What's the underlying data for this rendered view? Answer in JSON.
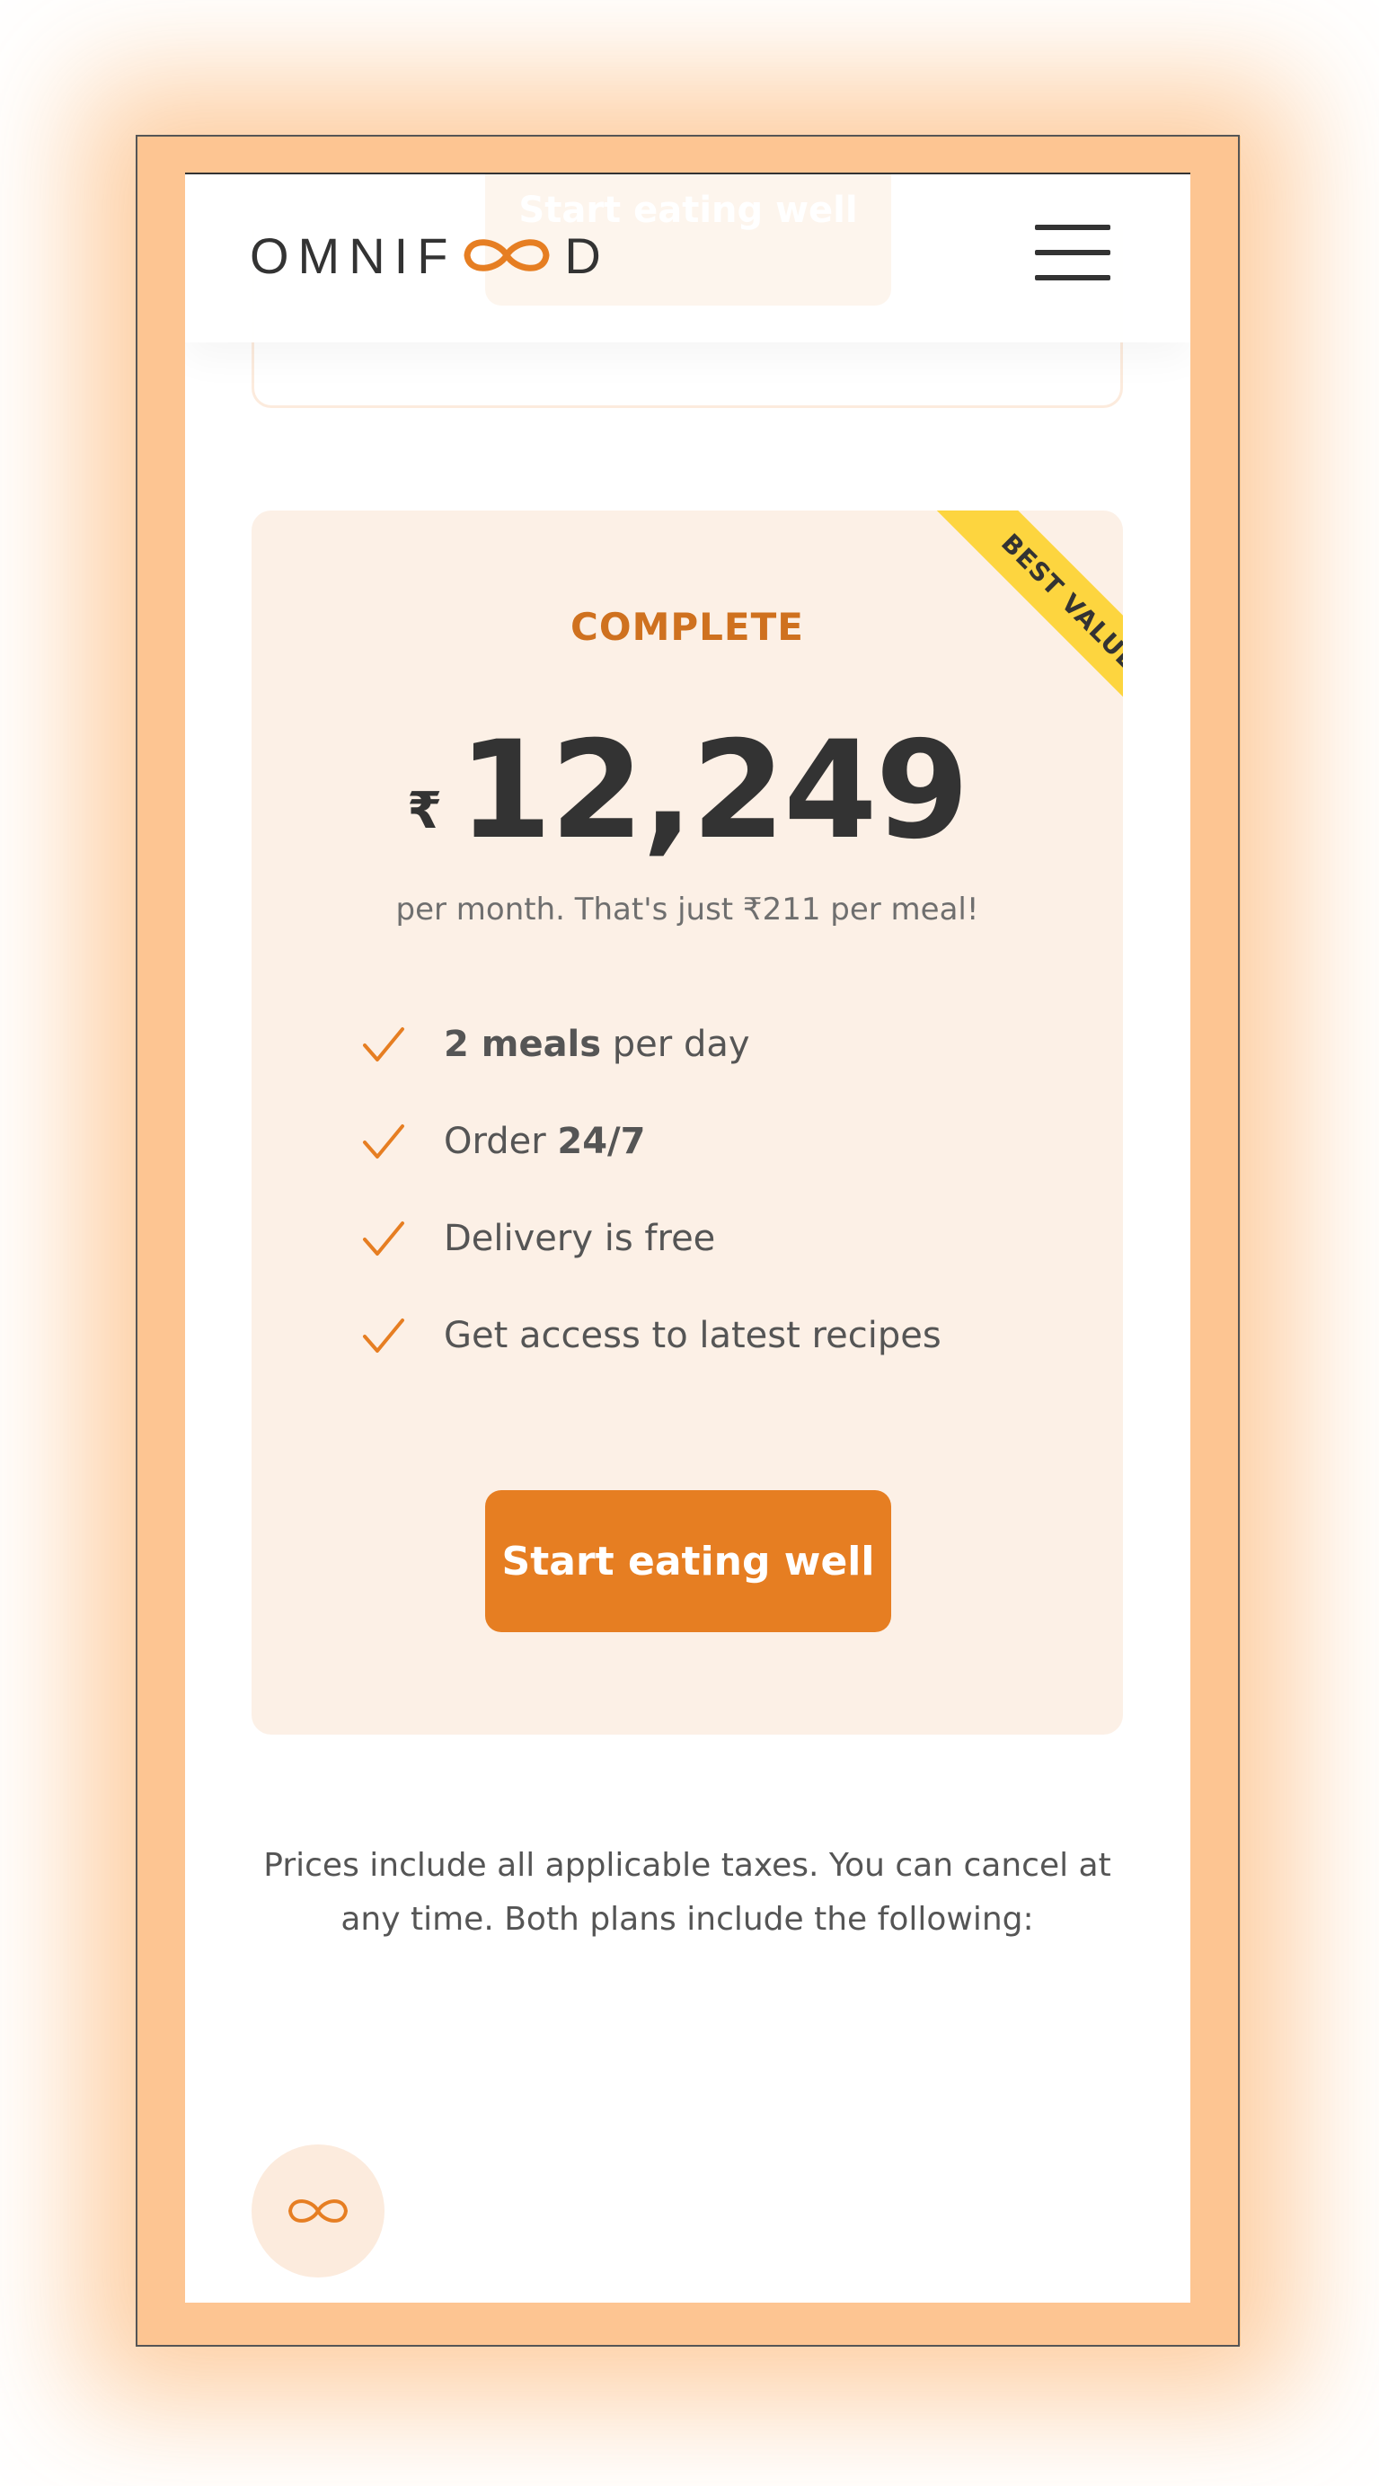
{
  "header": {
    "logo_text_left": "OMNIF",
    "logo_text_right": "D",
    "ghost_button_label": "Start eating well",
    "menu_icon": "hamburger-icon"
  },
  "plan": {
    "ribbon": "BEST VALUE",
    "name": "COMPLETE",
    "currency": "₹",
    "amount": "12,249",
    "note": "per month. That's just ₹211 per meal!",
    "features": [
      {
        "bold_first": "2 meals",
        "rest": " per day"
      },
      {
        "lead": "Order ",
        "bold_last": "24/7"
      },
      {
        "text": "Delivery is free"
      },
      {
        "text": "Get access to latest recipes"
      }
    ],
    "cta_label": "Start eating well"
  },
  "footnote": "Prices include all applicable taxes. You can cancel at any time. Both plans include the following:",
  "feature_icon": "infinity-icon",
  "colors": {
    "accent": "#e67e22",
    "accent_dark": "#cf711f",
    "ribbon": "#fdd53f",
    "card_bg": "#fcf0e6",
    "device_frame": "#fdc592",
    "text": "#333333"
  }
}
